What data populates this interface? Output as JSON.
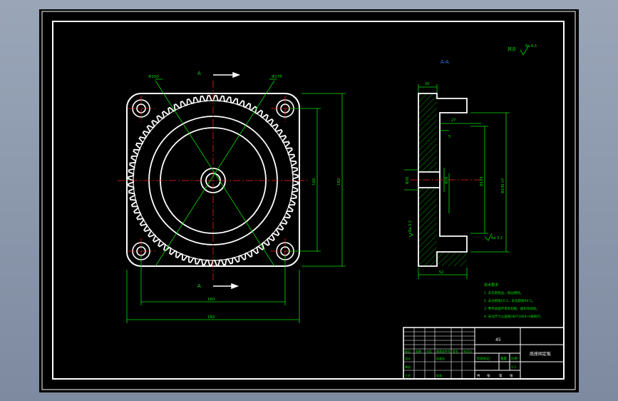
{
  "section_label": "A-A",
  "roughness_note": {
    "prefix": "其余",
    "value": "Ra 6.3"
  },
  "front_view": {
    "section_mark_top": "A",
    "section_mark_bottom": "A",
    "dims": {
      "d_bolt_circle": "Φ150",
      "d_outer": "Φ175",
      "width_inner": "160",
      "width_outer": "182",
      "height_inner": "160",
      "height_outer": "182"
    }
  },
  "section_view": {
    "dims": {
      "top_thick": "20",
      "step": "5",
      "small": "27",
      "hub_d": "Φ30",
      "bore_d": "Φ28",
      "d124": "Φ124",
      "d140": "Φ140 h7",
      "bottom": "52",
      "ra_left": "Ra 3.2",
      "ra_right": "Ra 3.2"
    }
  },
  "tech_notes": [
    "技术要求",
    "1. 去毛刺锐边，锐边倒钝。",
    "2. 未注倒角C0.5，未注圆角R0.5。",
    "3. 零件表面不得有划痕、碰伤等缺陷。",
    "4. 未注尺寸公差按GB/T1804-m级执行。"
  ],
  "title_block": {
    "material": "45",
    "part_name": "底座固定板",
    "scale_label": "比例",
    "weight_label": "重量",
    "scale_value": "1:1",
    "row_labels": [
      "标记",
      "处数",
      "分区",
      "更改文件号",
      "签名",
      "年月日"
    ],
    "design": "设计",
    "standardize": "标准化",
    "review": "审核",
    "process": "工艺",
    "approve": "批准",
    "stage_label": "阶段标记",
    "sheet_labels": [
      "共",
      "张",
      "第",
      "张"
    ]
  }
}
